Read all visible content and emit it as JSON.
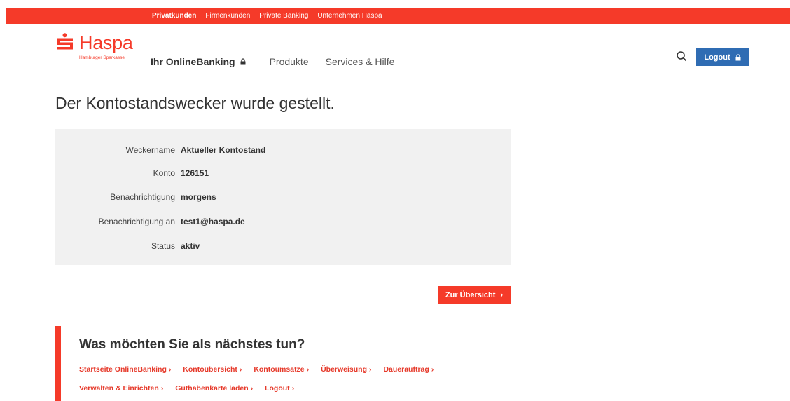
{
  "topnav": {
    "items": [
      {
        "label": "Privatkunden"
      },
      {
        "label": "Firmenkunden"
      },
      {
        "label": "Private Banking"
      },
      {
        "label": "Unternehmen Haspa"
      }
    ]
  },
  "brand": {
    "name": "Haspa",
    "subtitle": "Hamburger Sparkasse",
    "color": "#f53a29"
  },
  "mainnav": {
    "items": [
      {
        "label": "Ihr OnlineBanking",
        "icon": "lock-icon"
      },
      {
        "label": "Produkte"
      },
      {
        "label": "Services & Hilfe"
      }
    ]
  },
  "header": {
    "search_icon": "search-icon",
    "logout_label": "Logout",
    "logout_color": "#2f6cb3"
  },
  "page": {
    "title": "Der Kontostandswecker wurde gestellt."
  },
  "details": {
    "rows": [
      {
        "label": "Weckername",
        "value": "Aktueller Kontostand"
      },
      {
        "label": "Konto",
        "value": "126151"
      },
      {
        "label": "Benachrichtigung",
        "value": "morgens"
      },
      {
        "label": "Benachrichtigung an",
        "value": "test1@haspa.de"
      },
      {
        "label": "Status",
        "value": "aktiv"
      }
    ]
  },
  "actions": {
    "overview_label": "Zur Übersicht"
  },
  "next": {
    "heading": "Was möchten Sie als nächstes tun?",
    "links": [
      {
        "label": "Startseite OnlineBanking"
      },
      {
        "label": "Kontoübersicht"
      },
      {
        "label": "Kontoumsätze"
      },
      {
        "label": "Überweisung"
      },
      {
        "label": "Dauerauftrag"
      },
      {
        "label": "Verwalten & Einrichten"
      },
      {
        "label": "Guthabenkarte laden"
      },
      {
        "label": "Logout"
      }
    ]
  }
}
